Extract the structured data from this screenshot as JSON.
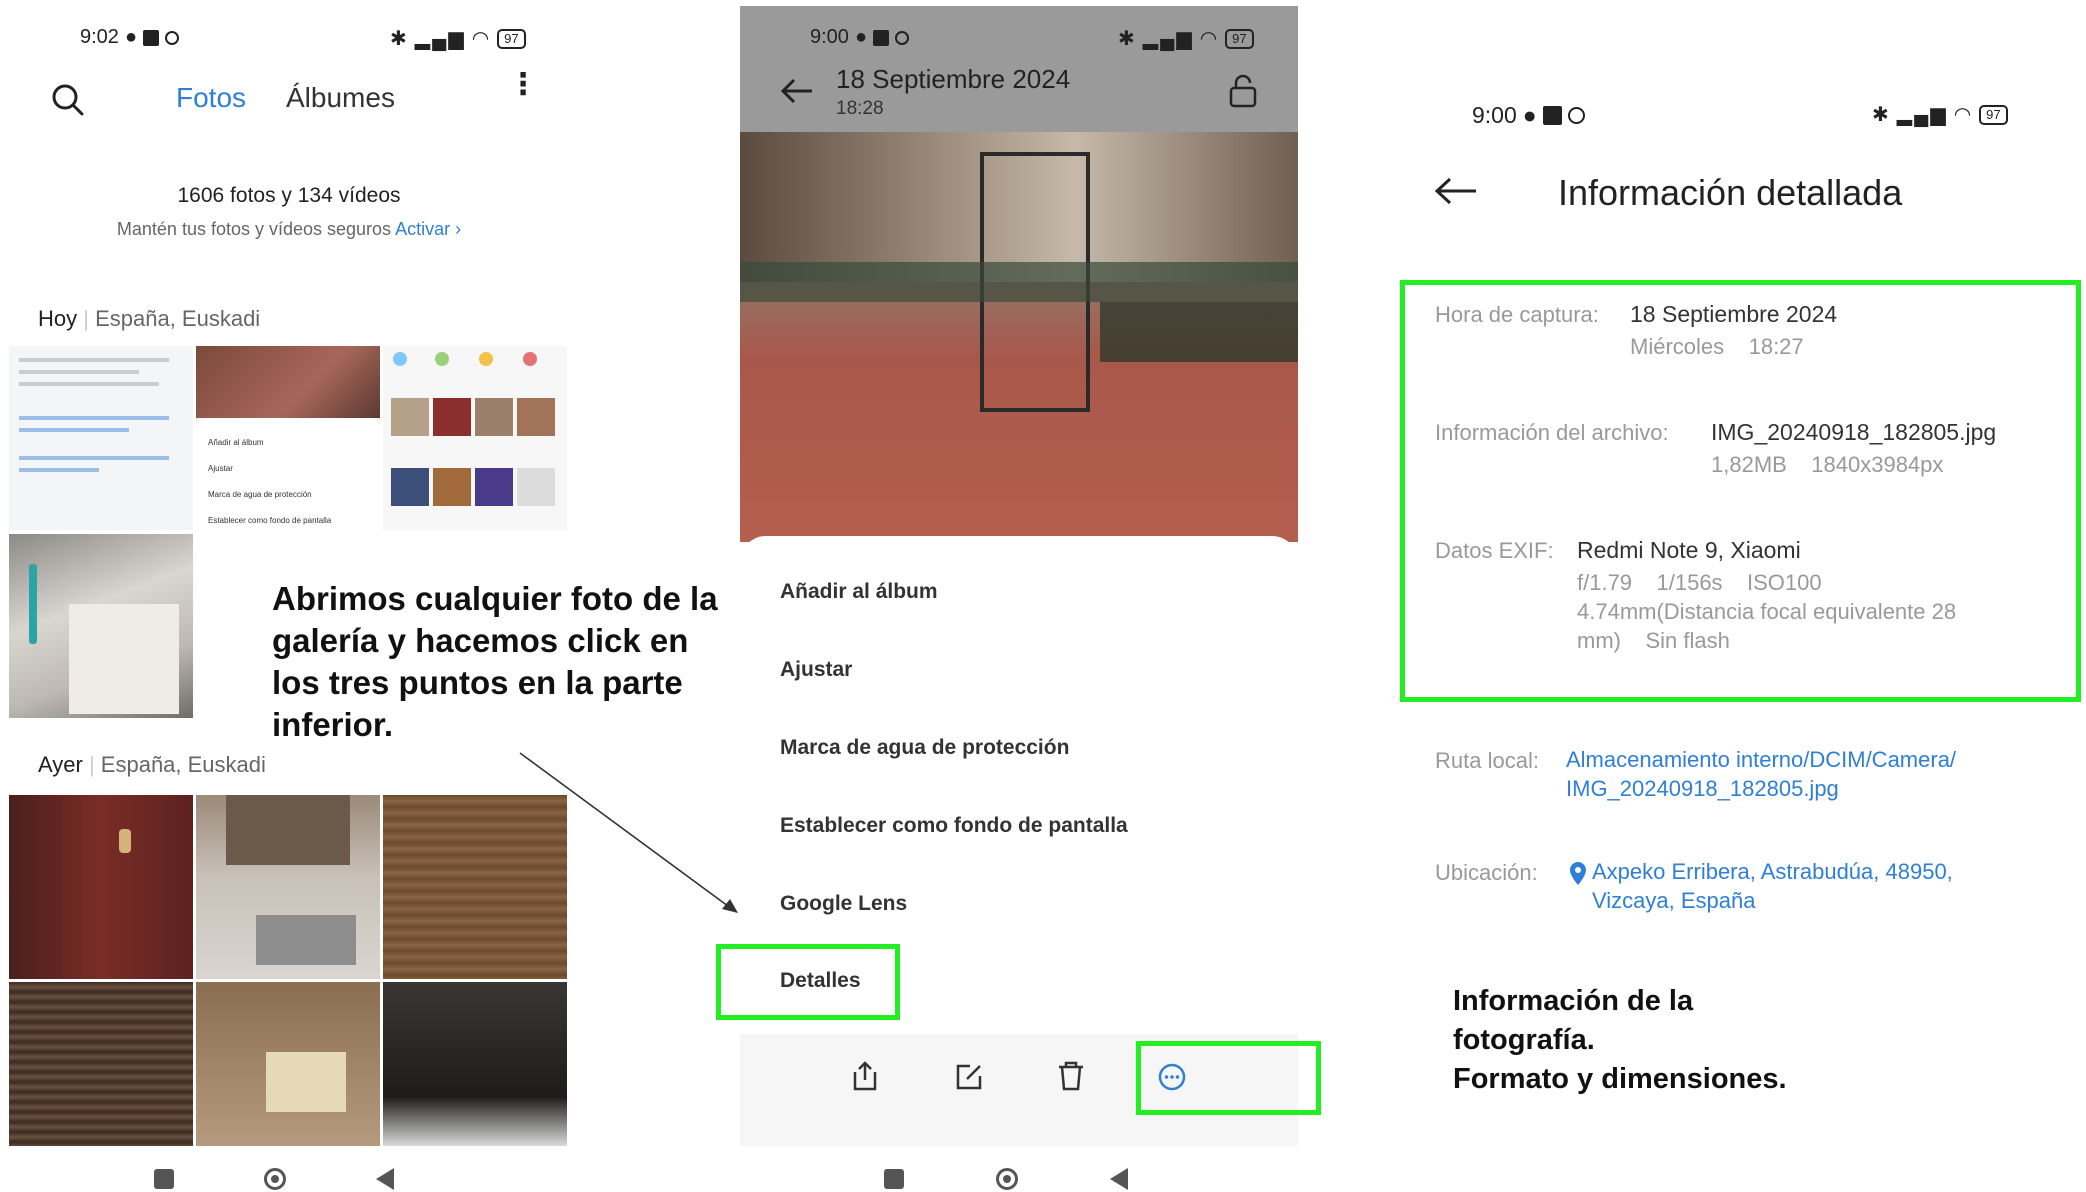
{
  "panel1": {
    "status_time": "9:02",
    "battery": "97",
    "tab_fotos": "Fotos",
    "tab_albumes": "Álbumes",
    "count": "1606 fotos y 134 vídeos",
    "secure_text": "Mantén tus fotos y vídeos seguros",
    "activate": "Activar",
    "today": "Hoy",
    "today_loc": "España, Euskadi",
    "yesterday": "Ayer",
    "yesterday_loc": "España, Euskadi",
    "thumb_menu": [
      "Añadir al álbum",
      "Ajustar",
      "Marca de agua de protección",
      "Establecer como fondo de pantalla"
    ]
  },
  "panel2": {
    "status_time": "9:00",
    "battery": "97",
    "date": "18 Septiembre 2024",
    "time": "18:28",
    "menu": [
      "Añadir al álbum",
      "Ajustar",
      "Marca de agua de protección",
      "Establecer como fondo de pantalla",
      "Google Lens",
      "Detalles"
    ]
  },
  "panel3": {
    "status_time": "9:00",
    "battery": "97",
    "title": "Información detallada",
    "capture_label": "Hora de captura:",
    "capture_date": "18 Septiembre 2024",
    "capture_day": "Miércoles",
    "capture_time": "18:27",
    "file_label": "Información del archivo:",
    "file_name": "IMG_20240918_182805.jpg",
    "file_size": "1,82MB",
    "file_dims": "1840x3984px",
    "exif_label": "Datos EXIF:",
    "exif_device": "Redmi Note 9, Xiaomi",
    "exif_aperture": "f/1.79",
    "exif_shutter": "1/156s",
    "exif_iso": "ISO100",
    "exif_focal": "4.74mm(Distancia focal equivalente 28",
    "exif_focal2": "mm)",
    "exif_flash": "Sin flash",
    "path_label": "Ruta local:",
    "path_line1": "Almacenamiento interno/DCIM/Camera/",
    "path_line2": "IMG_20240918_182805.jpg",
    "loc_label": "Ubicación:",
    "loc_line1": "Axpeko Erribera, Astrabudúa, 48950,",
    "loc_line2": "Vizcaya, España"
  },
  "annotations": {
    "left": [
      "Abrimos cualquier foto de la",
      "galería y hacemos click en",
      "los tres puntos en la parte",
      "inferior."
    ],
    "right": [
      "Información de la",
      "fotografía.",
      "Formato y dimensiones."
    ]
  },
  "colors": {
    "accent": "#2f7fd6",
    "highlight": "#22ee22"
  }
}
